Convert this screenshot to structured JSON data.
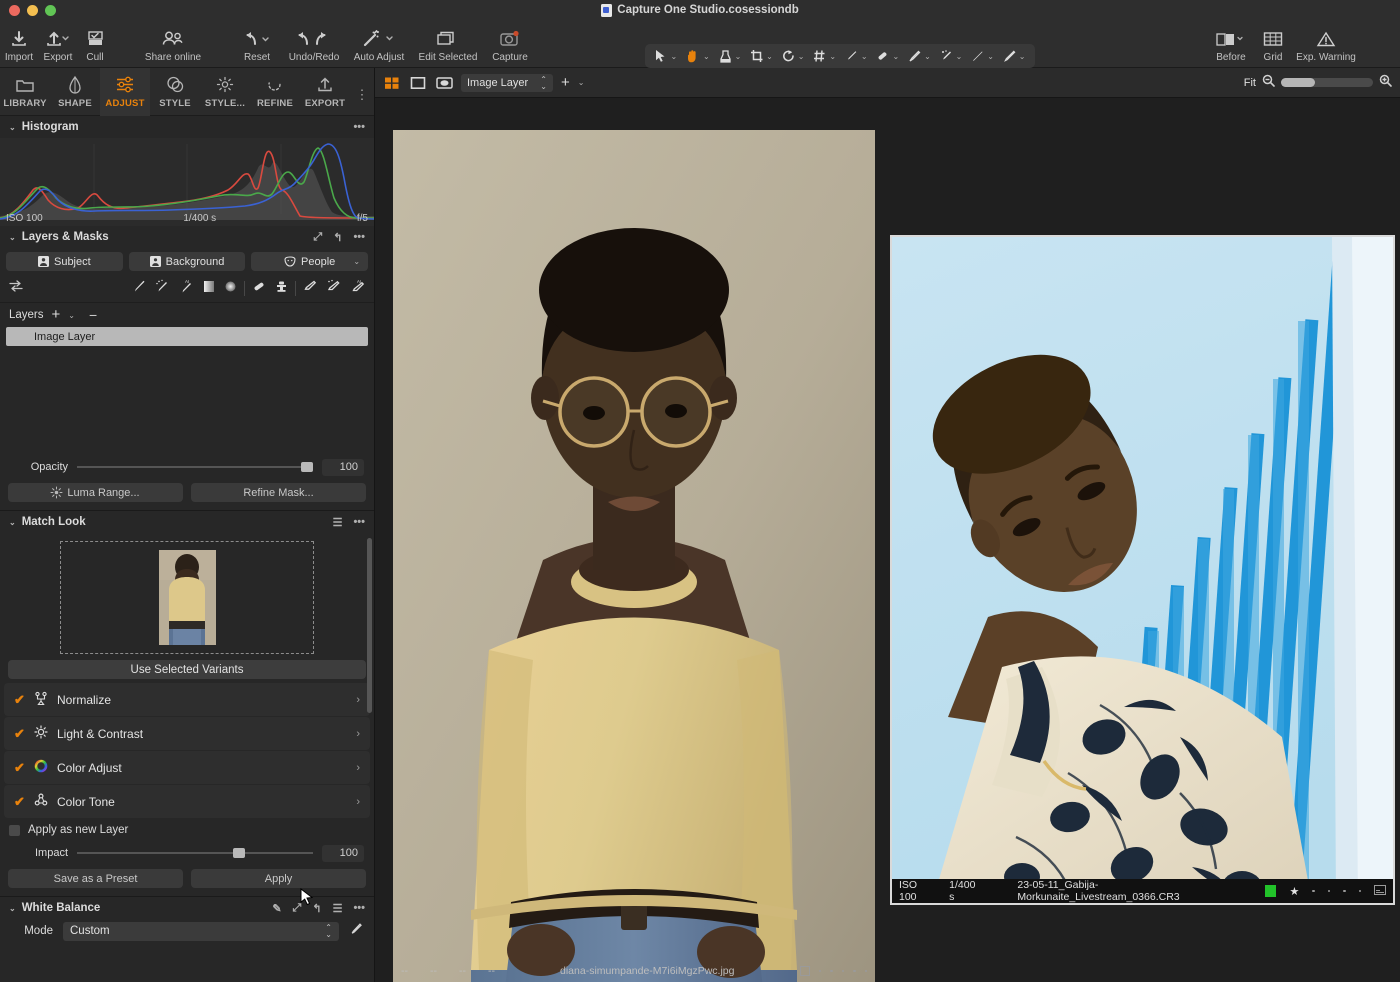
{
  "window": {
    "title": "Capture One Studio.cosessiondb",
    "traffic_lights": [
      "close",
      "minimize",
      "zoom"
    ]
  },
  "toolbar": {
    "items": [
      {
        "label": "Import",
        "icon": "import-icon",
        "has_chevron": false
      },
      {
        "label": "Export",
        "icon": "export-icon",
        "has_chevron": true
      },
      {
        "label": "Cull",
        "icon": "cull-icon",
        "has_chevron": false
      },
      {
        "label": "Share online",
        "icon": "share-online-icon",
        "has_chevron": false
      },
      {
        "label": "Reset",
        "icon": "reset-icon",
        "has_chevron": true
      },
      {
        "label": "Undo/Redo",
        "icon": "undo-redo-icon",
        "has_chevron": false
      },
      {
        "label": "Auto Adjust",
        "icon": "auto-adjust-icon",
        "has_chevron": true
      },
      {
        "label": "Edit Selected",
        "icon": "edit-selected-icon",
        "has_chevron": false
      },
      {
        "label": "Capture",
        "icon": "capture-icon",
        "has_chevron": false
      }
    ],
    "cursor_tools_label": "Cursor Tools",
    "cursor_tools": [
      "pointer-icon",
      "pan-hand-icon",
      "white-balance-picker-icon",
      "crop-icon",
      "rotate-icon",
      "keystone-icon",
      "spot-removal-icon",
      "eraser-icon",
      "heal-brush-icon",
      "clone-brush-icon",
      "draw-mask-brush-icon",
      "gradient-mask-icon"
    ],
    "right_items": [
      {
        "label": "Before",
        "icon": "before-after-icon",
        "has_chevron": true
      },
      {
        "label": "Grid",
        "icon": "grid-icon",
        "has_chevron": false
      },
      {
        "label": "Exp. Warning",
        "icon": "exposure-warning-icon",
        "has_chevron": false
      }
    ]
  },
  "left_panel": {
    "tabs": [
      {
        "label": "LIBRARY",
        "icon": "folder-icon",
        "active": false
      },
      {
        "label": "SHAPE",
        "icon": "shape-icon",
        "active": false
      },
      {
        "label": "ADJUST",
        "icon": "sliders-icon",
        "active": true
      },
      {
        "label": "STYLE",
        "icon": "style-icon",
        "active": false
      },
      {
        "label": "STYLE...",
        "icon": "style-brush-icon",
        "active": false
      },
      {
        "label": "REFINE",
        "icon": "refine-icon",
        "active": false
      },
      {
        "label": "EXPORT",
        "icon": "export-tab-icon",
        "active": false
      }
    ],
    "histogram": {
      "title": "Histogram",
      "iso": "ISO 100",
      "shutter": "1/400 s",
      "aperture": "f/5"
    },
    "layers_masks": {
      "title": "Layers & Masks",
      "pills": [
        {
          "label": "Subject",
          "icon": "person-icon",
          "chevron": false
        },
        {
          "label": "Background",
          "icon": "background-icon",
          "chevron": false
        },
        {
          "label": "People",
          "icon": "people-face-icon",
          "chevron": true
        }
      ],
      "layers_label": "Layers",
      "layer_rows": [
        {
          "name": "Image Layer",
          "selected": true
        }
      ],
      "opacity_label": "Opacity",
      "opacity_value": "100",
      "luma_range_label": "Luma Range...",
      "refine_mask_label": "Refine Mask..."
    },
    "match_look": {
      "title": "Match Look",
      "use_selected_variants_label": "Use Selected Variants",
      "options": [
        {
          "label": "Normalize",
          "checked": true,
          "icon": "normalize-icon"
        },
        {
          "label": "Light & Contrast",
          "checked": true,
          "icon": "light-contrast-icon"
        },
        {
          "label": "Color Adjust",
          "checked": true,
          "icon": "color-wheel-icon"
        },
        {
          "label": "Color Tone",
          "checked": true,
          "icon": "color-tone-icon"
        }
      ],
      "apply_as_new_layer_label": "Apply as new Layer",
      "apply_as_new_layer_checked": false,
      "impact_label": "Impact",
      "impact_value": "100",
      "save_preset_label": "Save as a Preset",
      "apply_label": "Apply"
    },
    "white_balance": {
      "title": "White Balance",
      "mode_label": "Mode",
      "mode_value": "Custom"
    }
  },
  "viewer": {
    "toolbar": {
      "grid_view_icon": "grid-view-icon",
      "single_view_icon": "single-view-icon",
      "preview_icon": "preview-icon",
      "layer_select_value": "Image Layer",
      "add_label": "+",
      "fit_label": "Fit"
    },
    "images": [
      {
        "filename": "diana-simumpande-M7i6iMgzPwc.jpg",
        "meta_dashes": [
          "--",
          "--",
          "--",
          "--"
        ],
        "rating_dots": 5,
        "selected": true
      },
      {
        "iso": "ISO 100",
        "shutter": "1/400 s",
        "filename": "23-05-11_Gabija-Morkunaite_Livestream_0366.CR3",
        "color_tag": "#22c32a",
        "star_rating": 1,
        "rating_dots": 4,
        "selected": false
      }
    ]
  },
  "colors": {
    "accent": "#e8820c",
    "panel_bg": "#272727",
    "toolbar_bg": "#2e2e2e",
    "viewer_bg": "#1f1f1f",
    "green_tag": "#22c32a"
  }
}
